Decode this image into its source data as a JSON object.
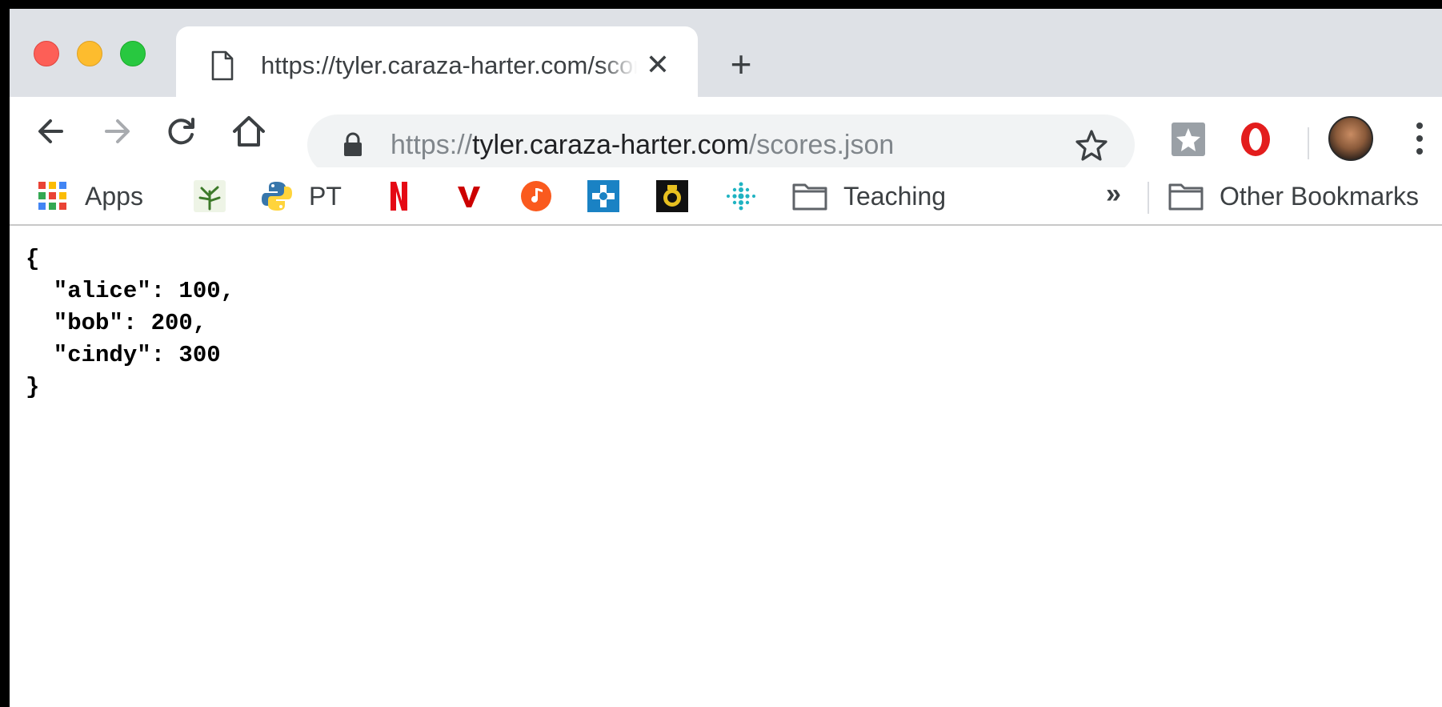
{
  "tab": {
    "title": "https://tyler.caraza-harter.com/scores.json",
    "close_glyph": "✕",
    "new_tab_glyph": "+"
  },
  "omnibox": {
    "scheme": "https://",
    "host": "tyler.caraza-harter.com",
    "path": "/scores.json"
  },
  "bookmarks": {
    "apps_label": "Apps",
    "pt_label": "PT",
    "teaching_label": "Teaching",
    "overflow_glyph": "»",
    "other_label": "Other Bookmarks"
  },
  "page": {
    "json_text": "{\n  \"alice\": 100,\n  \"bob\": 200,\n  \"cindy\": 300\n}"
  },
  "colors": {
    "tabstrip": "#dee1e6",
    "close_light": "#fd5f57",
    "minimize_light": "#fdbc2e",
    "maximize_light": "#28c840",
    "omnibox_bg": "#f1f3f4",
    "netflix_red": "#e50914",
    "vivaldi_red": "#cc0000",
    "music_orange": "#fa5a1e",
    "teal": "#1fb3c2"
  },
  "icons": {
    "tab": "document-icon",
    "back": "arrow-left-icon",
    "forward": "arrow-right-icon",
    "reload": "reload-icon",
    "home": "home-icon",
    "lock": "lock-icon",
    "star": "star-icon",
    "menu": "kebab-menu-icon"
  }
}
